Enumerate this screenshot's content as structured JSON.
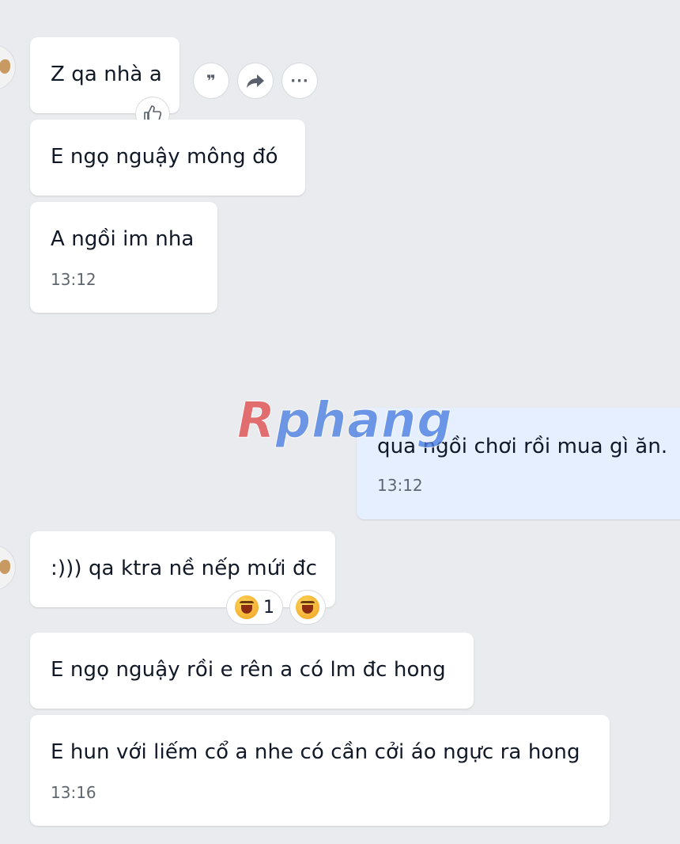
{
  "messages": [
    {
      "text": "Z qa nhà a"
    },
    {
      "text": "E ngọ nguậy mông đó"
    },
    {
      "text": "A ngồi im nha",
      "time": "13:12"
    },
    {
      "text": "qua ngồi chơi rồi mua gì ăn.",
      "time": "13:12"
    },
    {
      "text": ":))) qa ktra nề nếp mứi đc"
    },
    {
      "text": "E ngọ nguậy rồi e rên a có lm đc hong"
    },
    {
      "text": "E hun với liếm cổ a nhe có cần cởi áo ngực ra hong",
      "time": "13:16"
    }
  ],
  "reaction": {
    "count": "1"
  },
  "watermark": {
    "first": "R",
    "rest": "phang"
  },
  "icons": {
    "quote": "quote-icon",
    "forward": "forward-icon",
    "more": "more-icon",
    "like": "thumbs-up-icon",
    "haha": "laughing-emoji-icon"
  },
  "colors": {
    "background": "#e9ebef",
    "incoming_bubble": "#ffffff",
    "outgoing_bubble": "#e5efff",
    "time_text": "#5f6670"
  }
}
